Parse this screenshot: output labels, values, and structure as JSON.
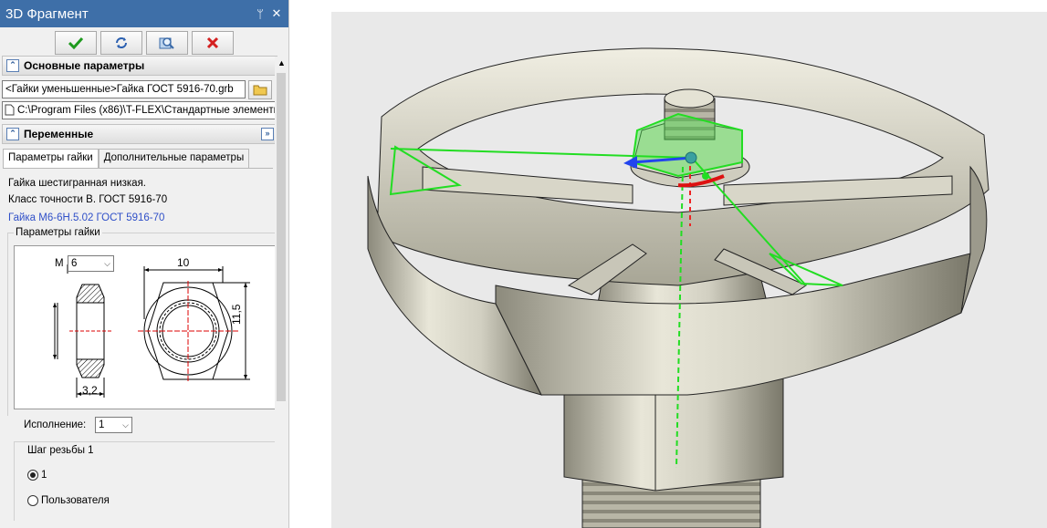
{
  "panel": {
    "title": "3D Фрагмент",
    "pin_glyph": "ᛘ",
    "close_glyph": "✕"
  },
  "toolbar": {
    "ok_icon": "check-icon",
    "refresh_icon": "refresh-icon",
    "preview_icon": "preview-icon",
    "cancel_icon": "cancel-icon"
  },
  "main_params": {
    "header": "Основные параметры",
    "library_path": "<Гайки уменьшенные>Гайка ГОСТ 5916-70.grb",
    "file_path": "C:\\Program Files (x86)\\T-FLEX\\Стандартные элементы :"
  },
  "variables": {
    "header": "Переменные",
    "tabs": [
      "Параметры гайки",
      "Дополнительные параметры"
    ],
    "desc_line1": "Гайка шестигранная низкая.",
    "desc_line2": "Класс точности B. ГОСТ 5916-70",
    "designation": "Гайка M6-6H.5.02 ГОСТ 5916-70",
    "group_label": "Параметры гайки",
    "drawing": {
      "m_label": "M",
      "m_value": "6",
      "width_dim": "10",
      "height_dim": "11,5",
      "thickness_dim": "3,2"
    },
    "execution_label": "Исполнение:",
    "execution_value": "1",
    "pitch_group": "Шаг резьбы 1",
    "pitch_option1": "1",
    "pitch_option2": "Пользователя"
  },
  "colors": {
    "title_bar": "#3e6fa8",
    "link_blue": "#3050c8",
    "gizmo_green": "#22dd22"
  }
}
